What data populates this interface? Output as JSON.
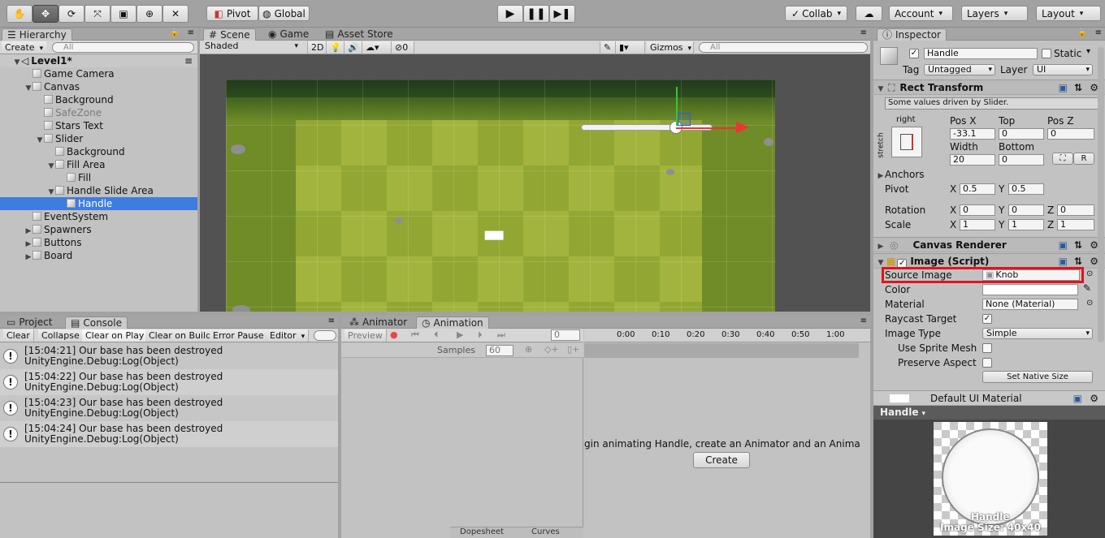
{
  "toolbar": {
    "pivot": "Pivot",
    "global": "Global",
    "collab": "Collab",
    "account": "Account",
    "layers": "Layers",
    "layout": "Layout"
  },
  "hierarchy": {
    "tab": "Hierarchy",
    "create": "Create",
    "search_placeholder": "All",
    "scene": "Level1*",
    "items": [
      {
        "label": "Game Camera",
        "indent": 1,
        "arrow": "",
        "dim": false,
        "selected": false
      },
      {
        "label": "Canvas",
        "indent": 1,
        "arrow": "▼",
        "dim": false,
        "selected": false
      },
      {
        "label": "Background",
        "indent": 2,
        "arrow": "",
        "dim": false,
        "selected": false
      },
      {
        "label": "SafeZone",
        "indent": 2,
        "arrow": "",
        "dim": true,
        "selected": false
      },
      {
        "label": "Stars Text",
        "indent": 2,
        "arrow": "",
        "dim": false,
        "selected": false
      },
      {
        "label": "Slider",
        "indent": 2,
        "arrow": "▼",
        "dim": false,
        "selected": false
      },
      {
        "label": "Background",
        "indent": 3,
        "arrow": "",
        "dim": false,
        "selected": false
      },
      {
        "label": "Fill Area",
        "indent": 3,
        "arrow": "▼",
        "dim": false,
        "selected": false
      },
      {
        "label": "Fill",
        "indent": 4,
        "arrow": "",
        "dim": false,
        "selected": false
      },
      {
        "label": "Handle Slide Area",
        "indent": 3,
        "arrow": "▼",
        "dim": false,
        "selected": false
      },
      {
        "label": "Handle",
        "indent": 4,
        "arrow": "",
        "dim": false,
        "selected": true
      },
      {
        "label": "EventSystem",
        "indent": 1,
        "arrow": "",
        "dim": false,
        "selected": false
      },
      {
        "label": "Spawners",
        "indent": 1,
        "arrow": "▶",
        "dim": false,
        "selected": false
      },
      {
        "label": "Buttons",
        "indent": 1,
        "arrow": "▶",
        "dim": false,
        "selected": false
      },
      {
        "label": "Board",
        "indent": 1,
        "arrow": "▶",
        "dim": false,
        "selected": false
      }
    ]
  },
  "scene": {
    "tabs": [
      "Scene",
      "Game",
      "Asset Store"
    ],
    "shading": "Shaded",
    "mode_2d": "2D",
    "hidden_count": "0",
    "gizmos": "Gizmos",
    "search_placeholder": "All"
  },
  "console": {
    "tabs": [
      "Project",
      "Console"
    ],
    "buttons": [
      "Clear",
      "Collapse",
      "Clear on Play",
      "Clear on Build",
      "Error Pause",
      "Editor"
    ],
    "entries": [
      {
        "line1": "[15:04:21] Our base has been destroyed",
        "line2": "UnityEngine.Debug:Log(Object)"
      },
      {
        "line1": "[15:04:22] Our base has been destroyed",
        "line2": "UnityEngine.Debug:Log(Object)"
      },
      {
        "line1": "[15:04:23] Our base has been destroyed",
        "line2": "UnityEngine.Debug:Log(Object)"
      },
      {
        "line1": "[15:04:24] Our base has been destroyed",
        "line2": "UnityEngine.Debug:Log(Object)"
      }
    ]
  },
  "animation": {
    "tabs": [
      "Animator",
      "Animation"
    ],
    "preview": "Preview",
    "frame": "0",
    "samples_label": "Samples",
    "samples": "60",
    "timeline": [
      "0:00",
      "0:10",
      "0:20",
      "0:30",
      "0:40",
      "0:50",
      "1:00"
    ],
    "message": "gin animating Handle, create an Animator and an Animatior",
    "create": "Create",
    "dopesheet": "Dopesheet",
    "curves": "Curves"
  },
  "inspector": {
    "tab": "Inspector",
    "name": "Handle",
    "static": "Static",
    "tag_label": "Tag",
    "tag": "Untagged",
    "layer_label": "Layer",
    "layer": "UI",
    "rect_transform": "Rect Transform",
    "driven_note": "Some values driven by Slider.",
    "anchor_top": "right",
    "anchor_side": "stretch",
    "pos_x_label": "Pos X",
    "top_label": "Top",
    "pos_z_label": "Pos Z",
    "pos_x": "-33.1",
    "top": "0",
    "pos_z": "0",
    "width_label": "Width",
    "bottom_label": "Bottom",
    "width": "20",
    "bottom": "0",
    "r_btn": "R",
    "anchors": "Anchors",
    "pivot_label": "Pivot",
    "pivot_x": "0.5",
    "pivot_y": "0.5",
    "rotation_label": "Rotation",
    "rot_x": "0",
    "rot_y": "0",
    "rot_z": "0",
    "scale_label": "Scale",
    "scale_x": "1",
    "scale_y": "1",
    "scale_z": "1",
    "x": "X",
    "y": "Y",
    "z": "Z",
    "canvas_renderer": "Canvas Renderer",
    "image_script": "Image (Script)",
    "source_image_label": "Source Image",
    "source_image": "Knob",
    "color_label": "Color",
    "material_label": "Material",
    "material": "None (Material)",
    "raycast_label": "Raycast Target",
    "image_type_label": "Image Type",
    "image_type": "Simple",
    "sprite_mesh_label": "Use Sprite Mesh",
    "preserve_label": "Preserve Aspect",
    "native_size": "Set Native Size",
    "default_material": "Default UI Material",
    "preview_title": "Handle",
    "preview_name": "Handle",
    "preview_size": "Image Size: 40x40"
  },
  "colors": {
    "selection": "#3e7ce0",
    "highlight_box": "#e0141c",
    "grass": "#7a9a2e"
  }
}
